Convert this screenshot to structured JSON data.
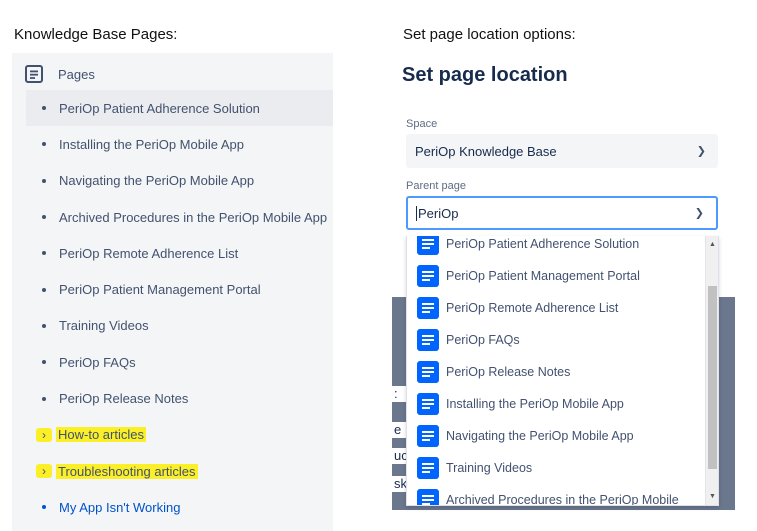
{
  "captions": {
    "left": "Knowledge Base Pages:",
    "right": "Set page location options:"
  },
  "sidebar": {
    "header": "Pages",
    "items": [
      {
        "label": "PeriOp Patient Adherence Solution",
        "kind": "bullet",
        "active": true
      },
      {
        "label": "Installing the PeriOp Mobile App",
        "kind": "bullet"
      },
      {
        "label": "Navigating the PeriOp Mobile App",
        "kind": "bullet"
      },
      {
        "label": "Archived Procedures in the PeriOp Mobile App",
        "kind": "bullet"
      },
      {
        "label": "PeriOp Remote Adherence List",
        "kind": "bullet"
      },
      {
        "label": "PeriOp Patient Management Portal",
        "kind": "bullet"
      },
      {
        "label": "Training Videos",
        "kind": "bullet"
      },
      {
        "label": "PeriOp FAQs",
        "kind": "bullet"
      },
      {
        "label": "PeriOp Release Notes",
        "kind": "bullet"
      },
      {
        "label": "How-to articles",
        "kind": "chevron",
        "highlighted": true
      },
      {
        "label": "Troubleshooting articles",
        "kind": "chevron",
        "highlighted": true
      },
      {
        "label": "My App Isn't Working",
        "kind": "bullet",
        "link": true
      }
    ]
  },
  "dialog": {
    "title": "Set page location",
    "space": {
      "label": "Space",
      "value": "PeriOp Knowledge Base"
    },
    "parent": {
      "label": "Parent page",
      "value": "PeriOp"
    },
    "options": [
      "PeriOp Patient Adherence Solution",
      "PeriOp Patient Management Portal",
      "PeriOp Remote Adherence List",
      "PeriOp FAQs",
      "PeriOp Release Notes",
      "Installing the PeriOp Mobile App",
      "Navigating the PeriOp Mobile App",
      "Training Videos",
      "Archived Procedures in the PeriOp Mobile"
    ],
    "background_fragments": [
      ":",
      "e",
      "uc",
      "sk"
    ]
  },
  "colors": {
    "highlight": "#fbef28",
    "accent": "#0065ff",
    "focus_border": "#4c9aff",
    "overlay": "#6b778c"
  }
}
